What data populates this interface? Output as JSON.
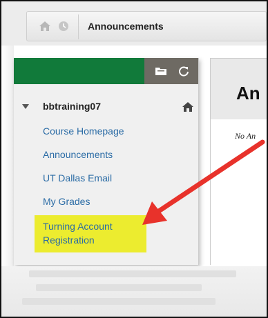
{
  "breadcrumb": {
    "title": "Announcements",
    "home_icon": "home-icon",
    "recent_icon": "clock-icon"
  },
  "course_menu": {
    "header_color": "#117a3a",
    "tools": [
      "folder-icon",
      "refresh-icon"
    ],
    "course_title": "bbtraining07",
    "items": [
      {
        "label": "Course Homepage"
      },
      {
        "label": "Announcements"
      },
      {
        "label": "UT Dallas Email"
      },
      {
        "label": "My Grades"
      },
      {
        "label": "Turning Account Registration",
        "highlighted": true
      }
    ]
  },
  "content": {
    "title": "An",
    "note": "No An"
  },
  "annotation": {
    "arrow_color": "#e8322b",
    "highlight_color": "#ecec2f"
  }
}
